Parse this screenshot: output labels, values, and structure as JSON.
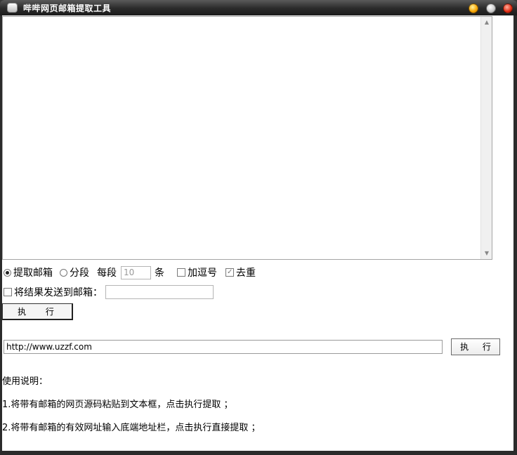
{
  "window": {
    "title": "哔哔网页邮箱提取工具"
  },
  "options": {
    "mode_extract_label": "提取邮箱",
    "mode_extract_selected": true,
    "mode_segment_label": "分段",
    "mode_segment_selected": false,
    "per_segment_label": "每段",
    "per_segment_value": "10",
    "per_segment_unit": "条",
    "add_comma_label": "加逗号",
    "add_comma_checked": false,
    "dedupe_label": "去重",
    "dedupe_checked": true
  },
  "send": {
    "label": "将结果发送到邮箱：",
    "checked": false,
    "email_value": ""
  },
  "buttons": {
    "execute_label": "执 行",
    "execute_url_label": "执 行"
  },
  "url": {
    "value": "http://www.uzzf.com"
  },
  "help": {
    "title": "使用说明：",
    "line1": "1.将带有邮箱的网页源码粘贴到文本框，点击执行提取 ；",
    "line2": "2.将带有邮箱的有效网址输入底端地址栏，点击执行直接提取 ；"
  },
  "colors": {
    "titlebar": "#2a2a2a",
    "title_text": "#ffffff",
    "client_bg": "#ffffff"
  },
  "icons": {
    "app": "app-icon",
    "minimize": "minimize-icon",
    "maximize": "maximize-icon",
    "close": "close-icon",
    "scroll_up": "triangle-up-icon",
    "scroll_down": "triangle-down-icon"
  }
}
